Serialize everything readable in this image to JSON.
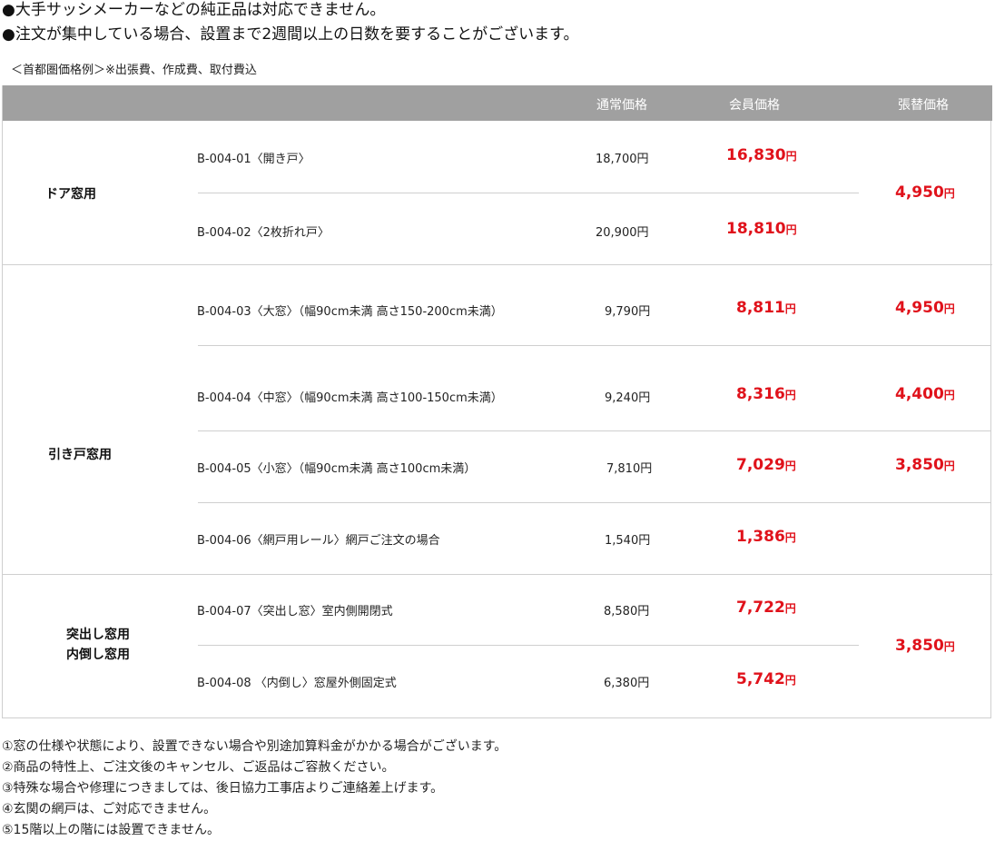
{
  "notices": [
    "●大手サッシメーカーなどの純正品は対応できません。",
    "●注文が集中している場合、設置まで2週間以上の日数を要することがございます。"
  ],
  "subtitle": "＜首都圏価格例＞※出張費、作成費、取付費込",
  "headers": {
    "regular": "通常価格",
    "member": "会員価格",
    "replace": "張替価格"
  },
  "yen": "円",
  "groups": {
    "door": "ドア窓用",
    "sliding": "引き戸窓用",
    "projecting_1": "突出し窓用",
    "projecting_2": "内倒し窓用"
  },
  "rows": [
    {
      "name": "B-004-01〈開き戸〉",
      "regular": "18,700円",
      "member": "16,830"
    },
    {
      "name": "B-004-02〈2枚折れ戸〉",
      "regular": "20,900円",
      "member": "18,810"
    },
    {
      "name": "B-004-03〈大窓〉（幅90cm未満 高さ150-200cm未満）",
      "regular": "9,790円",
      "member": "8,811"
    },
    {
      "name": "B-004-04〈中窓〉（幅90cm未満 高さ100-150cm未満）",
      "regular": "9,240円",
      "member": "8,316"
    },
    {
      "name": "B-004-05〈小窓〉（幅90cm未満 高さ100cm未満）",
      "regular": "7,810円",
      "member": "7,029"
    },
    {
      "name": "B-004-06〈網戸用レール〉網戸ご注文の場合",
      "regular": "1,540円",
      "member": "1,386"
    },
    {
      "name": "B-004-07〈突出し窓〉室内側開閉式",
      "regular": "8,580円",
      "member": "7,722"
    },
    {
      "name": "B-004-08 〈内倒し〉窓屋外側固定式",
      "regular": "6,380円",
      "member": "5,742"
    }
  ],
  "replace": {
    "door": "4,950",
    "large": "4,950",
    "medium": "4,400",
    "small": "3,850",
    "projecting": "3,850"
  },
  "notes": [
    "①窓の仕様や状態により、設置できない場合や別途加算料金がかかる場合がございます。",
    "②商品の特性上、ご注文後のキャンセル、ご返品はご容赦ください。",
    "③特殊な場合や修理につきましては、後日協力工事店よりご連絡差上げます。",
    "④玄関の網戸は、ご対応できません。",
    "⑤15階以上の階には設置できません。"
  ]
}
